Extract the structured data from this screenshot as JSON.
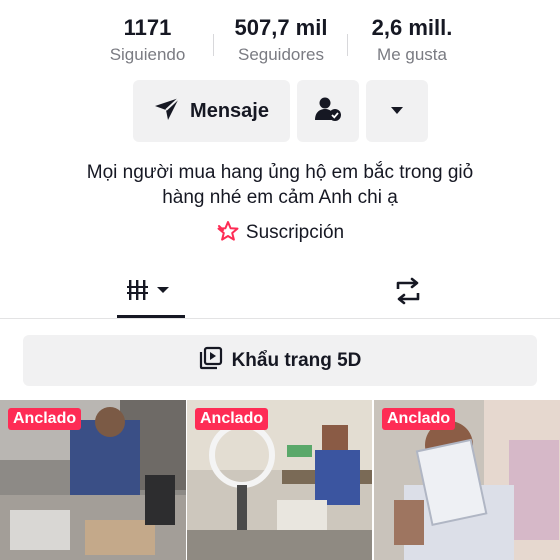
{
  "stats": [
    {
      "value": "1171",
      "label": "Siguiendo"
    },
    {
      "value": "507,7 mil",
      "label": "Seguidores"
    },
    {
      "value": "2,6 mill.",
      "label": "Me gusta"
    }
  ],
  "actions": {
    "message_label": "Mensaje",
    "message_icon": "send-icon",
    "friend_icon": "user-check-icon",
    "more_icon": "caret-down-icon"
  },
  "bio": {
    "line1": "Mọi người mua hang ủng hộ em bắc  trong giỏ",
    "line2": "hàng nhé em cảm Anh chi ạ"
  },
  "subscription": {
    "label": "Suscripción",
    "icon": "subscription-star-icon",
    "icon_color": "#fe2c55"
  },
  "tabs": [
    {
      "name": "videos",
      "icon": "grid-icon",
      "selected": true
    },
    {
      "name": "reposts",
      "icon": "repost-icon",
      "selected": false
    }
  ],
  "playlist": {
    "label": "Khẩu trang 5D",
    "icon": "playlist-icon"
  },
  "videos": [
    {
      "badge": "Anclado"
    },
    {
      "badge": "Anclado"
    },
    {
      "badge": "Anclado"
    }
  ],
  "colors": {
    "accent": "#fe2c55",
    "text": "#161823",
    "muted": "#7a7b82",
    "button_bg": "#f1f1f2"
  }
}
